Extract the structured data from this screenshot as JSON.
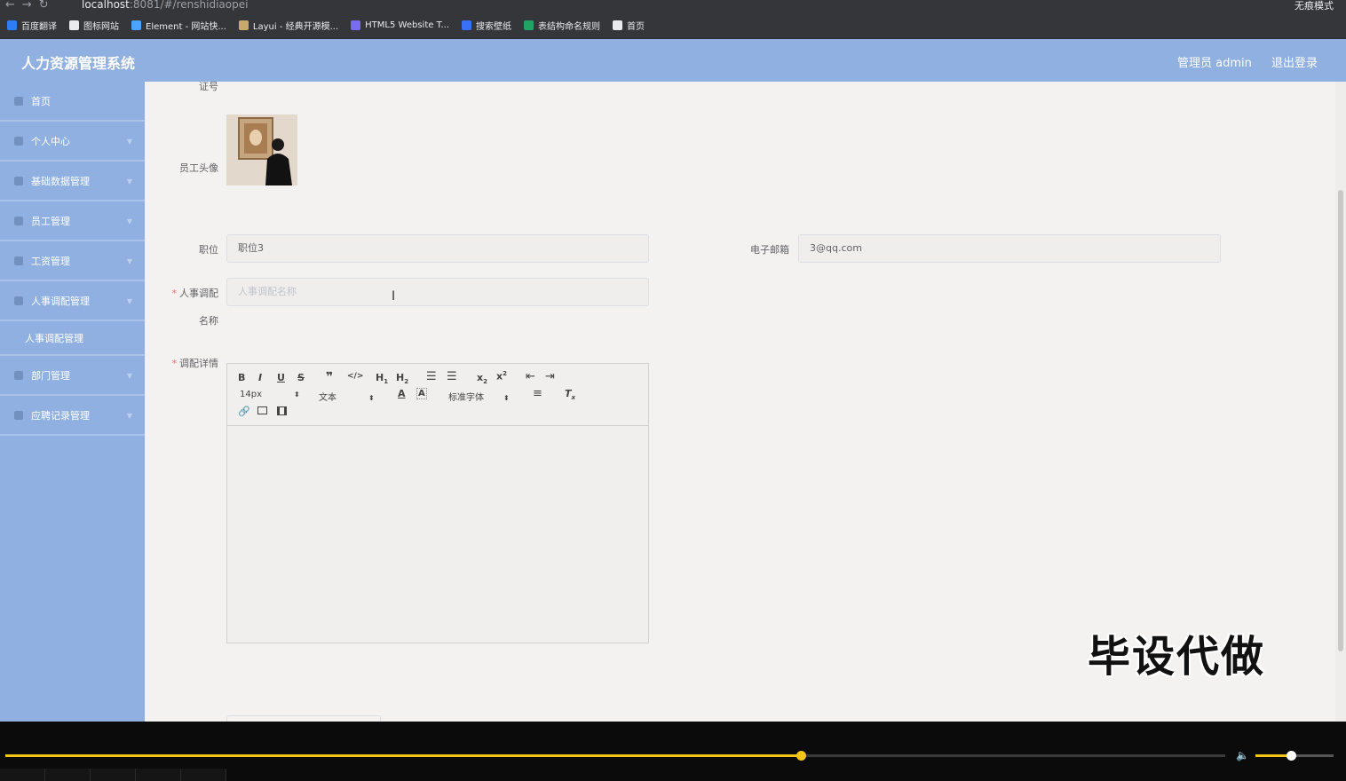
{
  "browser": {
    "url_host": "localhost",
    "url_path": ":8081/#/renshidiaopei",
    "incognito_label": "无痕模式",
    "bookmarks": [
      {
        "label": "百度翻译",
        "color": "#2f7df6"
      },
      {
        "label": "图标网站",
        "color": "#e8eaed"
      },
      {
        "label": "Element - 网站快...",
        "color": "#4aa3ff"
      },
      {
        "label": "Layui - 经典开源模...",
        "color": "#c9a96b"
      },
      {
        "label": "HTML5 Website T...",
        "color": "#7a6cf0"
      },
      {
        "label": "搜索壁纸",
        "color": "#3a6ff7"
      },
      {
        "label": "表结构命名规则",
        "color": "#1fa463"
      },
      {
        "label": "首页",
        "color": "#e8eaed"
      }
    ]
  },
  "app": {
    "title": "人力资源管理系统",
    "user_label": "管理员 admin",
    "logout_label": "退出登录"
  },
  "sidebar": {
    "items": [
      {
        "label": "首页",
        "icon": "home-icon"
      },
      {
        "label": "个人中心",
        "icon": "user-icon"
      },
      {
        "label": "基础数据管理",
        "icon": "database-icon"
      },
      {
        "label": "员工管理",
        "icon": "staff-icon"
      },
      {
        "label": "工资管理",
        "icon": "salary-icon"
      },
      {
        "label": "人事调配管理",
        "icon": "transfer-icon"
      }
    ],
    "sub_item": "人事调配管理",
    "items_after": [
      {
        "label": "部门管理",
        "icon": "department-icon"
      },
      {
        "label": "应聘记录管理",
        "icon": "record-icon"
      }
    ]
  },
  "form": {
    "id_label_tail": "证号",
    "avatar_label": "员工头像",
    "position_label": "职位",
    "position_value": "职位3",
    "email_label": "电子邮箱",
    "email_value": "3@qq.com",
    "transfer_name_label_1": "人事调配",
    "transfer_name_label_2": "名称",
    "transfer_name_placeholder": "人事调配名称",
    "detail_label": "调配详情"
  },
  "editor": {
    "font_size": "14px",
    "header_select": "文本",
    "font_family": "标准字体"
  },
  "watermark": "毕设代做",
  "player": {
    "progress": 0.652,
    "volume": 0.45
  }
}
